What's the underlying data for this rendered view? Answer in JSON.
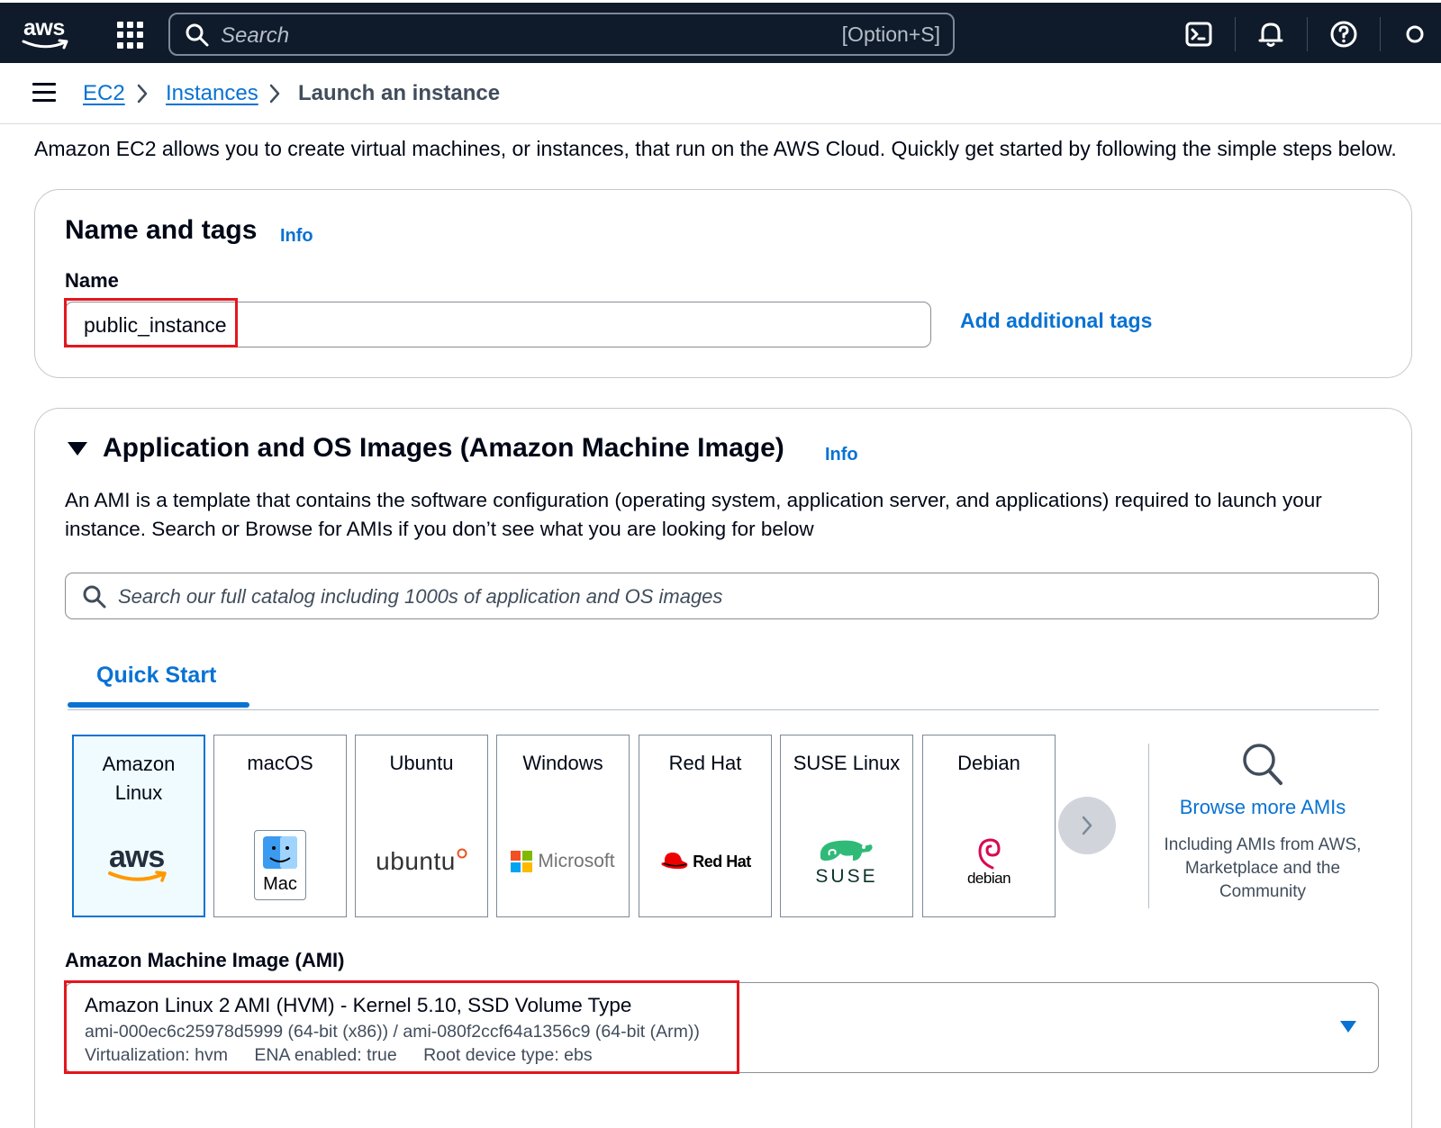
{
  "topbar": {
    "logo_text": "aws",
    "search_placeholder": "Search",
    "search_shortcut": "[Option+S]",
    "icons": [
      "cloudshell-icon",
      "bell-icon",
      "help-icon"
    ]
  },
  "breadcrumb": {
    "items": [
      "EC2",
      "Instances",
      "Launch an instance"
    ]
  },
  "intro": "Amazon EC2 allows you to create virtual machines, or instances, that run on the AWS Cloud. Quickly get started by following the simple steps below.",
  "name_tags": {
    "title": "Name and tags",
    "info": "Info",
    "name_label": "Name",
    "name_value": "public_instance",
    "add_tags": "Add additional tags"
  },
  "ami_section": {
    "title": "Application and OS Images (Amazon Machine Image)",
    "info": "Info",
    "description": "An AMI is a template that contains the software configuration (operating system, application server, and applications) required to launch your instance. Search or Browse for AMIs if you don’t see what you are looking for below",
    "search_placeholder": "Search our full catalog including 1000s of application and OS images",
    "tab": "Quick Start",
    "tiles": [
      {
        "name": "Amazon Linux",
        "logo": "aws",
        "selected": true
      },
      {
        "name": "macOS",
        "logo": "Mac"
      },
      {
        "name": "Ubuntu",
        "logo": "ubuntu"
      },
      {
        "name": "Windows",
        "logo": "Microsoft"
      },
      {
        "name": "Red Hat",
        "logo": "Red Hat"
      },
      {
        "name": "SUSE Linux",
        "logo": "SUSE"
      },
      {
        "name": "Debian",
        "logo": "debian"
      }
    ],
    "browse_more": "Browse more AMIs",
    "browse_sub": "Including AMIs from AWS, Marketplace and the Community",
    "ami_label": "Amazon Machine Image (AMI)",
    "selected_ami": {
      "title": "Amazon Linux 2 AMI (HVM) - Kernel 5.10, SSD Volume Type",
      "ids": "ami-000ec6c25978d5999 (64-bit (x86)) / ami-080f2ccf64a1356c9 (64-bit (Arm))",
      "virtualization": "Virtualization: hvm",
      "ena": "ENA enabled: true",
      "root_device": "Root device type: ebs"
    }
  },
  "colors": {
    "topbar_bg": "#0f1b2a",
    "link": "#0972d3",
    "highlight_red": "#e3161e",
    "selected_tile_bg": "#f0fbff"
  }
}
